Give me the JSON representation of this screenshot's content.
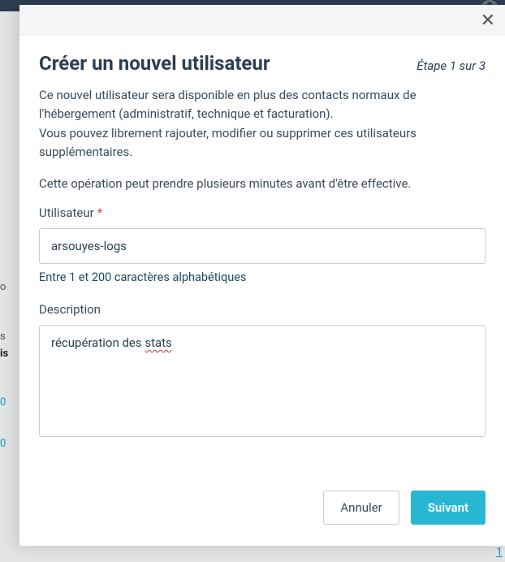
{
  "background": {
    "lang": "FR",
    "leftFragments": [
      "o",
      "s",
      "is",
      "0",
      "0"
    ],
    "pageNum": "1"
  },
  "modal": {
    "title": "Créer un nouvel utilisateur",
    "step": "Étape 1 sur 3",
    "description_line1": "Ce nouvel utilisateur sera disponible en plus des contacts normaux de l'hébergement (administratif, technique et facturation).",
    "description_line2": "Vous pouvez librement rajouter, modifier ou supprimer ces utilisateurs supplémentaires.",
    "warning": "Cette opération peut prendre plusieurs minutes avant d'être effective.",
    "fields": {
      "username": {
        "label": "Utilisateur",
        "required": "*",
        "value": "arsouyes-logs",
        "hint": "Entre 1 et 200 caractères alphabétiques"
      },
      "description": {
        "label": "Description",
        "value_prefix": "récupération des ",
        "value_spellerr": "stats"
      }
    },
    "buttons": {
      "cancel": "Annuler",
      "next": "Suivant"
    }
  }
}
